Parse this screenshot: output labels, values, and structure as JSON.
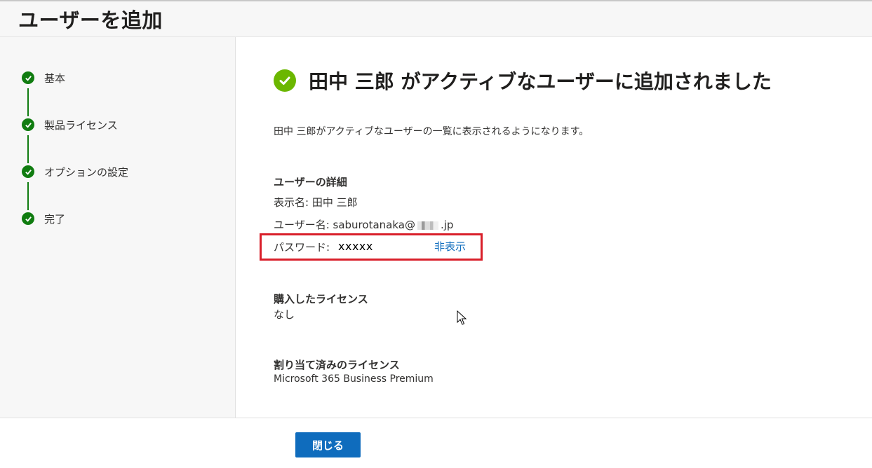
{
  "header": {
    "title": "ユーザーを追加"
  },
  "steps": [
    {
      "label": "基本"
    },
    {
      "label": "製品ライセンス"
    },
    {
      "label": "オプションの設定"
    },
    {
      "label": "完了"
    }
  ],
  "main": {
    "success_title": "田中 三郎 がアクティブなユーザーに追加されました",
    "description": "田中 三郎がアクティブなユーザーの一覧に表示されるようになります。",
    "user_details": {
      "title": "ユーザーの詳細",
      "display_name": "表示名: 田中 三郎",
      "username_prefix": "ユーザー名: saburotanaka@",
      "username_suffix": ".jp",
      "password_label": "パスワード:",
      "password_value": "xxxxx",
      "password_toggle": "非表示"
    },
    "purchased": {
      "title": "購入したライセンス",
      "value": "なし"
    },
    "assigned": {
      "title": "割り当て済みのライセンス",
      "value": "Microsoft 365 Business Premium"
    }
  },
  "footer": {
    "close_label": "閉じる"
  },
  "colors": {
    "step_green": "#107c10",
    "success_green": "#6bb700",
    "primary_blue": "#0f6cbd",
    "highlight_red": "#d91f2a"
  }
}
